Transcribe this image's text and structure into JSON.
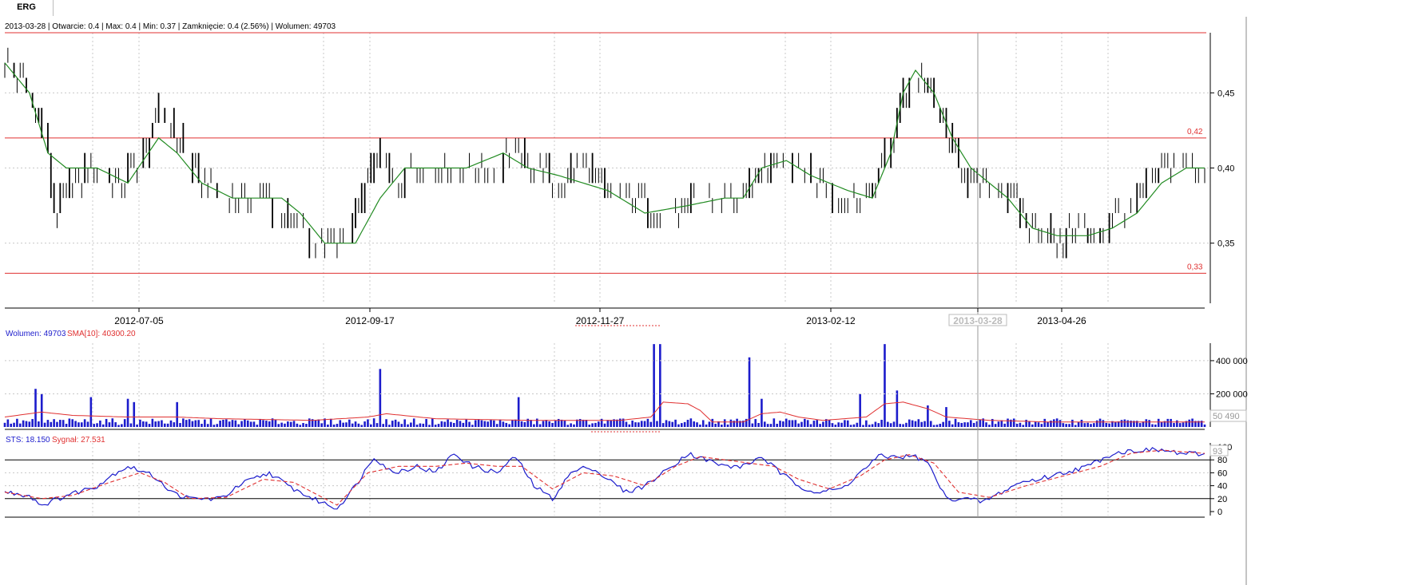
{
  "tab": {
    "label": "ERG"
  },
  "info_bar": {
    "text": "2013-03-28 | Otwarcie: 0.4 | Max: 0.4 | Min: 0.37 | Zamknięcie: 0.4 (2.56%)  | Wolumen: 49703"
  },
  "volume_header": {
    "vol_label": "Wolumen: 49703",
    "sma_label": "SMA[10]: 40300.20"
  },
  "stoch_header": {
    "sts_label": "STS: 18.150",
    "signal_label": "Sygnał: 27.531"
  },
  "colors": {
    "bar": "#000000",
    "sma_price": "#228b22",
    "hline": "#e03030",
    "volume": "#1c1ccc",
    "volume_sma": "#e03030",
    "sts": "#1c1ccc",
    "signal": "#e03030",
    "grid": "#c8c8c8"
  },
  "chart_data": [
    {
      "type": "ohlc",
      "date_ticks": [
        "2012-07-05",
        "2012-09-17",
        "2012-11-27",
        "2013-02-12",
        "2013-03-28",
        "2013-04-26"
      ],
      "highlighted_date": "2013-03-28",
      "ylim": [
        0.31,
        0.49
      ],
      "y_ticks": [
        "0,35",
        "0,40",
        "0,45"
      ],
      "horizontal_lines": [
        {
          "value": 0.33,
          "label": "0,33"
        },
        {
          "value": 0.42,
          "label": "0,42"
        },
        {
          "value": 0.49,
          "label": ""
        }
      ],
      "close_anchors": [
        [
          0,
          0.47
        ],
        [
          8,
          0.45
        ],
        [
          14,
          0.41
        ],
        [
          16,
          0.37
        ],
        [
          22,
          0.39
        ],
        [
          30,
          0.4
        ],
        [
          36,
          0.39
        ],
        [
          44,
          0.4
        ],
        [
          50,
          0.44
        ],
        [
          56,
          0.42
        ],
        [
          64,
          0.39
        ],
        [
          72,
          0.38
        ],
        [
          84,
          0.38
        ],
        [
          94,
          0.36
        ],
        [
          102,
          0.35
        ],
        [
          112,
          0.35
        ],
        [
          120,
          0.41
        ],
        [
          126,
          0.39
        ],
        [
          134,
          0.4
        ],
        [
          150,
          0.4
        ],
        [
          158,
          0.4
        ],
        [
          165,
          0.41
        ],
        [
          172,
          0.4
        ],
        [
          180,
          0.39
        ],
        [
          188,
          0.4
        ],
        [
          196,
          0.38
        ],
        [
          204,
          0.38
        ],
        [
          212,
          0.37
        ],
        [
          220,
          0.37
        ],
        [
          226,
          0.38
        ],
        [
          234,
          0.38
        ],
        [
          240,
          0.38
        ],
        [
          246,
          0.4
        ],
        [
          252,
          0.41
        ],
        [
          258,
          0.4
        ],
        [
          264,
          0.39
        ],
        [
          272,
          0.38
        ],
        [
          280,
          0.38
        ],
        [
          285,
          0.4
        ],
        [
          290,
          0.43
        ],
        [
          294,
          0.46
        ],
        [
          298,
          0.46
        ],
        [
          302,
          0.44
        ],
        [
          308,
          0.41
        ],
        [
          314,
          0.39
        ],
        [
          322,
          0.39
        ],
        [
          328,
          0.38
        ],
        [
          332,
          0.36
        ],
        [
          336,
          0.36
        ],
        [
          342,
          0.35
        ],
        [
          348,
          0.36
        ],
        [
          354,
          0.35
        ],
        [
          360,
          0.37
        ],
        [
          366,
          0.37
        ],
        [
          372,
          0.39
        ],
        [
          378,
          0.4
        ],
        [
          384,
          0.4
        ],
        [
          390,
          0.4
        ]
      ],
      "sma_price_anchors": [
        [
          0,
          0.47
        ],
        [
          8,
          0.45
        ],
        [
          14,
          0.41
        ],
        [
          20,
          0.4
        ],
        [
          30,
          0.4
        ],
        [
          40,
          0.39
        ],
        [
          50,
          0.42
        ],
        [
          56,
          0.41
        ],
        [
          64,
          0.39
        ],
        [
          74,
          0.38
        ],
        [
          90,
          0.38
        ],
        [
          96,
          0.37
        ],
        [
          104,
          0.35
        ],
        [
          114,
          0.35
        ],
        [
          122,
          0.38
        ],
        [
          130,
          0.4
        ],
        [
          150,
          0.4
        ],
        [
          162,
          0.41
        ],
        [
          170,
          0.4
        ],
        [
          180,
          0.395
        ],
        [
          196,
          0.385
        ],
        [
          208,
          0.37
        ],
        [
          222,
          0.375
        ],
        [
          234,
          0.38
        ],
        [
          240,
          0.38
        ],
        [
          246,
          0.4
        ],
        [
          254,
          0.405
        ],
        [
          262,
          0.395
        ],
        [
          274,
          0.385
        ],
        [
          282,
          0.38
        ],
        [
          288,
          0.41
        ],
        [
          292,
          0.45
        ],
        [
          296,
          0.465
        ],
        [
          302,
          0.45
        ],
        [
          308,
          0.42
        ],
        [
          314,
          0.4
        ],
        [
          326,
          0.38
        ],
        [
          334,
          0.36
        ],
        [
          342,
          0.355
        ],
        [
          352,
          0.355
        ],
        [
          360,
          0.36
        ],
        [
          368,
          0.37
        ],
        [
          376,
          0.39
        ],
        [
          384,
          0.4
        ],
        [
          390,
          0.4
        ]
      ]
    },
    {
      "type": "bar",
      "title": "Wolumen",
      "ylim": [
        0,
        520000
      ],
      "y_ticks": [
        "200 000",
        "400 000"
      ],
      "last_value_label": "50 490",
      "spikes": [
        [
          10,
          230000
        ],
        [
          12,
          200000
        ],
        [
          28,
          180000
        ],
        [
          40,
          170000
        ],
        [
          42,
          150000
        ],
        [
          56,
          150000
        ],
        [
          122,
          350000
        ],
        [
          167,
          180000
        ],
        [
          211,
          500000
        ],
        [
          213,
          500000
        ],
        [
          242,
          420000
        ],
        [
          246,
          170000
        ],
        [
          278,
          200000
        ],
        [
          286,
          500000
        ],
        [
          290,
          220000
        ],
        [
          300,
          130000
        ],
        [
          306,
          120000
        ]
      ],
      "sma_anchors": [
        [
          0,
          60000
        ],
        [
          12,
          90000
        ],
        [
          22,
          70000
        ],
        [
          40,
          60000
        ],
        [
          56,
          60000
        ],
        [
          70,
          50000
        ],
        [
          100,
          40000
        ],
        [
          118,
          60000
        ],
        [
          124,
          80000
        ],
        [
          140,
          50000
        ],
        [
          170,
          40000
        ],
        [
          200,
          40000
        ],
        [
          210,
          60000
        ],
        [
          214,
          150000
        ],
        [
          222,
          140000
        ],
        [
          226,
          100000
        ],
        [
          230,
          30000
        ],
        [
          240,
          30000
        ],
        [
          246,
          80000
        ],
        [
          252,
          90000
        ],
        [
          258,
          60000
        ],
        [
          266,
          40000
        ],
        [
          280,
          60000
        ],
        [
          286,
          140000
        ],
        [
          292,
          150000
        ],
        [
          300,
          110000
        ],
        [
          306,
          60000
        ],
        [
          320,
          40000
        ],
        [
          340,
          30000
        ],
        [
          390,
          30000
        ]
      ]
    },
    {
      "type": "line",
      "title": "STS",
      "ylim": [
        0,
        100
      ],
      "y_ticks": [
        "0",
        "20",
        "40",
        "60",
        "80",
        "100"
      ],
      "horizontal_lines": [
        20,
        80
      ],
      "last_value_label": "93",
      "sts_anchors": [
        [
          0,
          30
        ],
        [
          8,
          25
        ],
        [
          12,
          10
        ],
        [
          20,
          25
        ],
        [
          30,
          40
        ],
        [
          36,
          60
        ],
        [
          40,
          70
        ],
        [
          46,
          60
        ],
        [
          50,
          50
        ],
        [
          54,
          30
        ],
        [
          60,
          20
        ],
        [
          70,
          20
        ],
        [
          78,
          45
        ],
        [
          86,
          60
        ],
        [
          92,
          40
        ],
        [
          100,
          20
        ],
        [
          108,
          5
        ],
        [
          114,
          40
        ],
        [
          120,
          85
        ],
        [
          126,
          60
        ],
        [
          134,
          70
        ],
        [
          140,
          60
        ],
        [
          146,
          90
        ],
        [
          152,
          70
        ],
        [
          160,
          60
        ],
        [
          166,
          85
        ],
        [
          172,
          40
        ],
        [
          178,
          20
        ],
        [
          184,
          60
        ],
        [
          190,
          70
        ],
        [
          196,
          50
        ],
        [
          202,
          30
        ],
        [
          208,
          40
        ],
        [
          214,
          60
        ],
        [
          222,
          90
        ],
        [
          228,
          80
        ],
        [
          234,
          70
        ],
        [
          240,
          70
        ],
        [
          246,
          85
        ],
        [
          252,
          60
        ],
        [
          258,
          40
        ],
        [
          264,
          30
        ],
        [
          272,
          35
        ],
        [
          278,
          60
        ],
        [
          284,
          85
        ],
        [
          290,
          85
        ],
        [
          296,
          85
        ],
        [
          300,
          75
        ],
        [
          306,
          20
        ],
        [
          312,
          20
        ],
        [
          318,
          15
        ],
        [
          324,
          30
        ],
        [
          330,
          45
        ],
        [
          336,
          50
        ],
        [
          344,
          60
        ],
        [
          352,
          70
        ],
        [
          360,
          90
        ],
        [
          368,
          95
        ],
        [
          376,
          95
        ],
        [
          382,
          90
        ],
        [
          390,
          88
        ]
      ],
      "signal_anchors": [
        [
          0,
          30
        ],
        [
          12,
          20
        ],
        [
          22,
          25
        ],
        [
          34,
          45
        ],
        [
          44,
          60
        ],
        [
          52,
          45
        ],
        [
          60,
          20
        ],
        [
          72,
          22
        ],
        [
          84,
          50
        ],
        [
          94,
          45
        ],
        [
          108,
          10
        ],
        [
          118,
          60
        ],
        [
          128,
          70
        ],
        [
          140,
          70
        ],
        [
          150,
          75
        ],
        [
          160,
          70
        ],
        [
          168,
          70
        ],
        [
          178,
          35
        ],
        [
          188,
          60
        ],
        [
          198,
          55
        ],
        [
          208,
          40
        ],
        [
          218,
          70
        ],
        [
          226,
          85
        ],
        [
          234,
          80
        ],
        [
          242,
          75
        ],
        [
          250,
          70
        ],
        [
          258,
          50
        ],
        [
          268,
          35
        ],
        [
          278,
          55
        ],
        [
          286,
          80
        ],
        [
          294,
          88
        ],
        [
          302,
          75
        ],
        [
          310,
          30
        ],
        [
          320,
          22
        ],
        [
          332,
          40
        ],
        [
          344,
          55
        ],
        [
          356,
          70
        ],
        [
          366,
          90
        ],
        [
          376,
          95
        ],
        [
          390,
          90
        ]
      ]
    }
  ]
}
